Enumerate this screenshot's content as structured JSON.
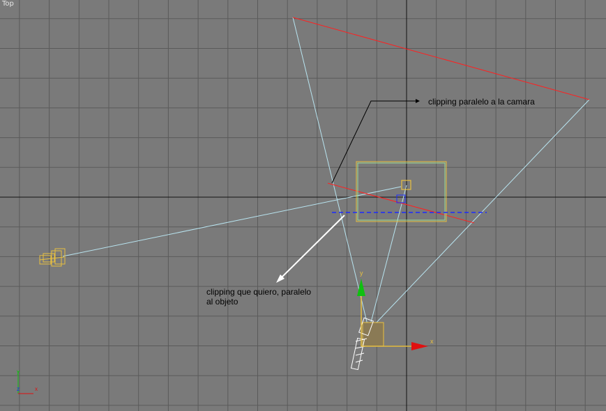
{
  "viewport": {
    "label": "Top",
    "background": "#7a7a7a",
    "grid_color": "#5a5a5a",
    "axis_color": "#111111"
  },
  "annotations": {
    "camera_clipping": "clipping paralelo a la camara",
    "object_clipping_line1": "clipping que quiero, paralelo",
    "object_clipping_line2": "al objeto"
  },
  "gizmo": {
    "x_label": "x",
    "y_label": "y"
  },
  "view_axes": {
    "x_label": "x",
    "y_label": "y",
    "z_label": "z"
  },
  "colors": {
    "frustum": "#b8e4f0",
    "clip_plane": "#ff2020",
    "selection": "#e8c040",
    "gizmo_x": "#e01010",
    "gizmo_y": "#10c010",
    "dashed_line": "#1a2aff",
    "arrow_white": "#ffffff"
  }
}
